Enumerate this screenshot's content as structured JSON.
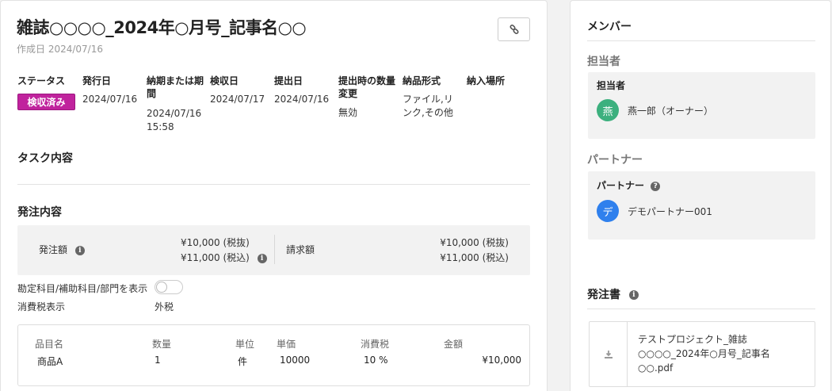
{
  "header": {
    "title": "雑誌○○○○_2024年○月号_記事名○○",
    "created": "作成日 2024/07/16"
  },
  "details": {
    "status_label": "ステータス",
    "status_value": "検収済み",
    "issue_date_label": "発行日",
    "issue_date_value": "2024/07/16",
    "deadline_label_1": "納期または期",
    "deadline_label_2": "間",
    "deadline_value_1": "2024/07/16",
    "deadline_value_2": "15:58",
    "inspection_label": "検収日",
    "inspection_value": "2024/07/17",
    "submit_label": "提出日",
    "submit_value": "2024/07/16",
    "qty_change_label_1": "提出時の数量",
    "qty_change_label_2": "変更",
    "qty_change_value": "無効",
    "format_label": "納品形式",
    "format_value_1": "ファイル,リ",
    "format_value_2": "ンク,その他",
    "place_label": "納入場所"
  },
  "task": {
    "title": "タスク内容"
  },
  "order": {
    "title": "発注内容",
    "order_amount_label": "発注額",
    "order_amount_ex": "¥10,000 (税抜)",
    "order_amount_in": "¥11,000 (税込)",
    "invoice_label": "請求額",
    "invoice_ex": "¥10,000 (税抜)",
    "invoice_in": "¥11,000 (税込)",
    "account_toggle_label": "勘定科目/補助科目/部門を表示",
    "tax_display_label": "消費税表示",
    "tax_display_value": "外税"
  },
  "items": {
    "headers": [
      "品目名",
      "数量",
      "単位",
      "単価",
      "消費税",
      "金額"
    ],
    "rows": [
      [
        "商品A",
        "1",
        "件",
        "10000",
        "10 %",
        "¥10,000"
      ]
    ]
  },
  "members": {
    "title": "メンバー",
    "assignee_section": "担当者",
    "assignee_box_title": "担当者",
    "assignee_avatar": "燕",
    "assignee_name": "燕一郎（オーナー）",
    "partner_section": "パートナー",
    "partner_box_title": "パートナー",
    "partner_avatar": "デ",
    "partner_name": "デモパートナー001"
  },
  "order_doc": {
    "title": "発注書",
    "file_name_1": "テストプロジェクト_雑誌",
    "file_name_2": "○○○○_2024年○月号_記事名",
    "file_name_3": "○○.pdf"
  },
  "colors": {
    "status_badge": "#c0239d",
    "assignee_avatar": "#3cb07e",
    "partner_avatar": "#2f80ed"
  },
  "icons": [
    "link-icon",
    "info-icon",
    "question-icon",
    "download-icon"
  ]
}
